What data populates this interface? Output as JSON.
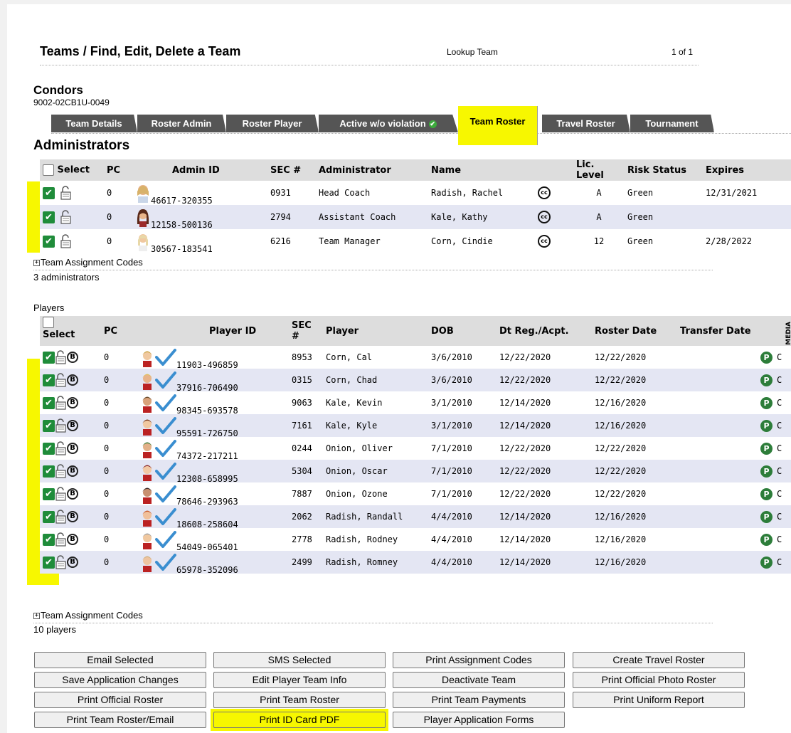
{
  "header": {
    "title": "Teams / Find, Edit, Delete a Team",
    "lookup": "Lookup Team",
    "page": "1 of 1"
  },
  "team": {
    "name": "Condors",
    "code": "9002-02CB1U-0049"
  },
  "tabs": [
    {
      "label": "Team Details"
    },
    {
      "label": "Roster Admin"
    },
    {
      "label": "Roster Player"
    },
    {
      "label": "Active w/o violation"
    },
    {
      "label": "Team Roster"
    },
    {
      "label": "Travel Roster"
    },
    {
      "label": "Tournament"
    }
  ],
  "administrators": {
    "heading": "Administrators",
    "columns": {
      "select": "Select",
      "pc": "PC",
      "admin_id": "Admin ID",
      "sec": "SEC #",
      "administrator": "Administrator",
      "name": "Name",
      "lic_level": "Lic. Level",
      "risk_status": "Risk Status",
      "expires": "Expires"
    },
    "rows": [
      {
        "pc": "0",
        "admin_id": "46617-320355",
        "sec": "0931",
        "role": "Head Coach",
        "name": "Radish, Rachel",
        "lic": "A",
        "risk": "Green",
        "expires": "12/31/2021"
      },
      {
        "pc": "0",
        "admin_id": "12158-500136",
        "sec": "2794",
        "role": "Assistant Coach",
        "name": "Kale, Kathy",
        "lic": "A",
        "risk": "Green",
        "expires": ""
      },
      {
        "pc": "0",
        "admin_id": "30567-183541",
        "sec": "6216",
        "role": "Team Manager",
        "name": "Corn, Cindie",
        "lic": "12",
        "risk": "Green",
        "expires": "2/28/2022"
      }
    ],
    "assignment_codes": "Team Assignment Codes",
    "count": "3 administrators"
  },
  "players": {
    "heading": "Players",
    "columns": {
      "select": "Select",
      "pc": "PC",
      "player_id": "Player ID",
      "sec": "SEC #",
      "player": "Player",
      "dob": "DOB",
      "dt_reg": "Dt Reg./Acpt.",
      "roster_date": "Roster Date",
      "transfer_date": "Transfer Date",
      "media": "MEDIA"
    },
    "rows": [
      {
        "pc": "0",
        "player_id": "11903-496859",
        "sec": "8953",
        "name": "Corn, Cal",
        "dob": "3/6/2010",
        "dt_reg": "12/22/2020",
        "roster_date": "12/22/2020",
        "transfer_date": ""
      },
      {
        "pc": "0",
        "player_id": "37916-706490",
        "sec": "0315",
        "name": "Corn, Chad",
        "dob": "3/6/2010",
        "dt_reg": "12/22/2020",
        "roster_date": "12/22/2020",
        "transfer_date": ""
      },
      {
        "pc": "0",
        "player_id": "98345-693578",
        "sec": "9063",
        "name": "Kale, Kevin",
        "dob": "3/1/2010",
        "dt_reg": "12/14/2020",
        "roster_date": "12/16/2020",
        "transfer_date": ""
      },
      {
        "pc": "0",
        "player_id": "95591-726750",
        "sec": "7161",
        "name": "Kale, Kyle",
        "dob": "3/1/2010",
        "dt_reg": "12/14/2020",
        "roster_date": "12/16/2020",
        "transfer_date": ""
      },
      {
        "pc": "0",
        "player_id": "74372-217211",
        "sec": "0244",
        "name": "Onion, Oliver",
        "dob": "7/1/2010",
        "dt_reg": "12/22/2020",
        "roster_date": "12/22/2020",
        "transfer_date": ""
      },
      {
        "pc": "0",
        "player_id": "12308-658995",
        "sec": "5304",
        "name": "Onion, Oscar",
        "dob": "7/1/2010",
        "dt_reg": "12/22/2020",
        "roster_date": "12/22/2020",
        "transfer_date": ""
      },
      {
        "pc": "0",
        "player_id": "78646-293963",
        "sec": "7887",
        "name": "Onion, Ozone",
        "dob": "7/1/2010",
        "dt_reg": "12/22/2020",
        "roster_date": "12/22/2020",
        "transfer_date": ""
      },
      {
        "pc": "0",
        "player_id": "18608-258604",
        "sec": "2062",
        "name": "Radish, Randall",
        "dob": "4/4/2010",
        "dt_reg": "12/14/2020",
        "roster_date": "12/16/2020",
        "transfer_date": ""
      },
      {
        "pc": "0",
        "player_id": "54049-065401",
        "sec": "2778",
        "name": "Radish, Rodney",
        "dob": "4/4/2010",
        "dt_reg": "12/14/2020",
        "roster_date": "12/16/2020",
        "transfer_date": ""
      },
      {
        "pc": "0",
        "player_id": "65978-352096",
        "sec": "2499",
        "name": "Radish, Romney",
        "dob": "4/4/2010",
        "dt_reg": "12/14/2020",
        "roster_date": "12/16/2020",
        "transfer_date": ""
      }
    ],
    "assignment_codes": "Team Assignment Codes",
    "count": "10 players"
  },
  "badges": {
    "b": "B",
    "p": "P",
    "cc": "cc",
    "check": "✔",
    "cut": "C"
  },
  "buttons": {
    "email_selected": "Email Selected",
    "sms_selected": "SMS Selected",
    "print_assignment_codes": "Print Assignment Codes",
    "create_travel_roster": "Create Travel Roster",
    "save_application_changes": "Save Application Changes",
    "edit_player_team_info": "Edit Player Team Info",
    "deactivate_team": "Deactivate Team",
    "print_official_photo_roster": "Print Official Photo Roster",
    "print_official_roster": "Print Official Roster",
    "print_team_roster": "Print Team Roster",
    "print_team_payments": "Print Team Payments",
    "print_uniform_report": "Print Uniform Report",
    "print_team_roster_email": "Print Team Roster/Email",
    "print_id_card_pdf": "Print ID Card PDF",
    "player_application_forms": "Player Application Forms"
  },
  "colors": {
    "highlight": "#f7f700",
    "checkbox": "#1f8c3a",
    "row_alt": "#e4e6f3",
    "tab": "#555555"
  }
}
